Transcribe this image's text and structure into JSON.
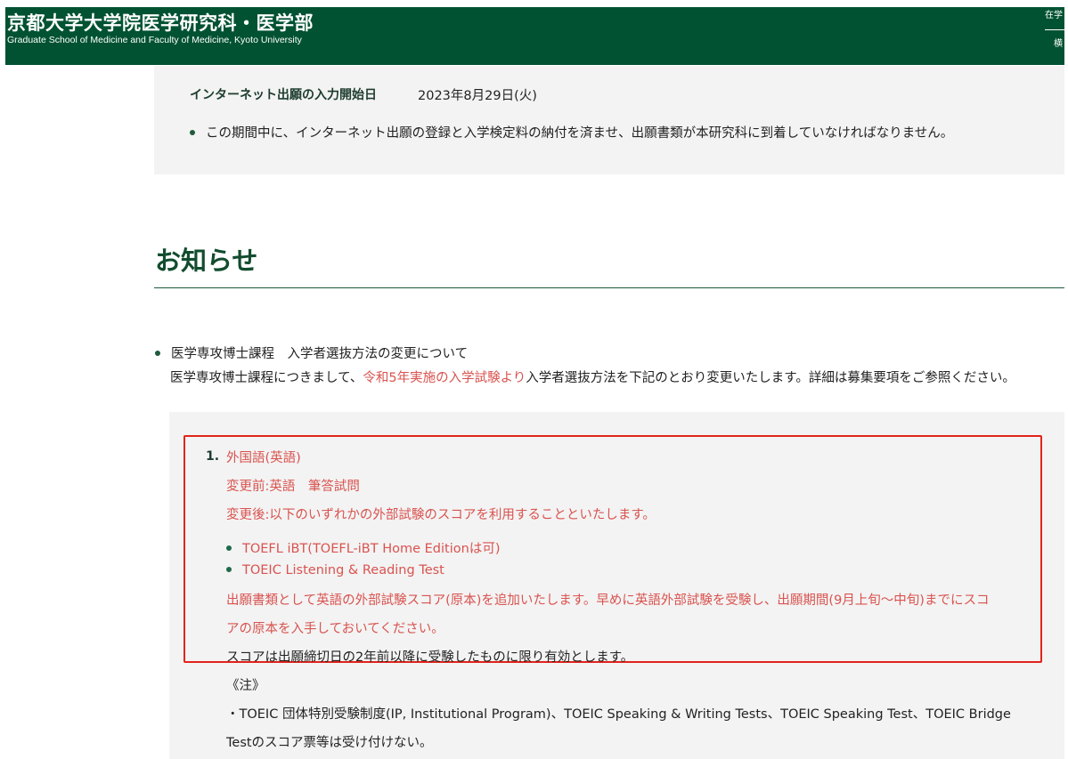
{
  "header": {
    "title_ja": "京都大学大学院医学研究科・医学部",
    "title_en": "Graduate School of Medicine and Faculty of Medicine, Kyoto University",
    "right_top": "在学",
    "right_bottom": "横"
  },
  "schedule": {
    "label": "インターネット出願の入力開始日",
    "date": "2023年8月29日(火)",
    "note": "この期間中に、インターネット出願の登録と入学検定料の納付を済ませ、出願書類が本研究科に到着していなければなりません。"
  },
  "notice": {
    "title": "お知らせ",
    "item_head": "医学専攻博士課程　入学者選抜方法の変更について",
    "body_pre": "医学専攻博士課程につきまして、",
    "body_red": "令和5年実施の入学試験より",
    "body_post": "入学者選抜方法を下記のとおり変更いたします。詳細は募集要項をご参照ください。"
  },
  "changes": {
    "number": "1.",
    "heading": "外国語(英語)",
    "before": "変更前:英語　筆答試問",
    "after": "変更後:以下のいずれかの外部試験のスコアを利用することといたします。",
    "tests": [
      "TOEFL iBT(TOEFL-iBT Home Editionは可)",
      "TOEIC Listening & Reading Test"
    ],
    "submit_line1": "出願書類として英語の外部試験スコア(原本)を追加いたします。早めに英語外部試験を受験し、出願期間(9月上旬～中旬)までにスコ",
    "submit_line2": "アの原本を入手しておいてください。",
    "validity": "スコアは出願締切日の2年前以降に受験したものに限り有効とします。",
    "note_label": "《注》",
    "note_line1": "・TOEIC 団体特別受験制度(IP, Institutional Program)、TOEIC Speaking & Writing Tests、TOEIC Speaking Test、TOEIC Bridge",
    "note_line2": "Testのスコア票等は受け付けない。"
  },
  "colors": {
    "header_bg": "#005232",
    "accent_green": "#124c2e",
    "red_text": "#d9534f",
    "highlight_border": "#e2231a",
    "panel_bg": "#f3f3f3"
  }
}
